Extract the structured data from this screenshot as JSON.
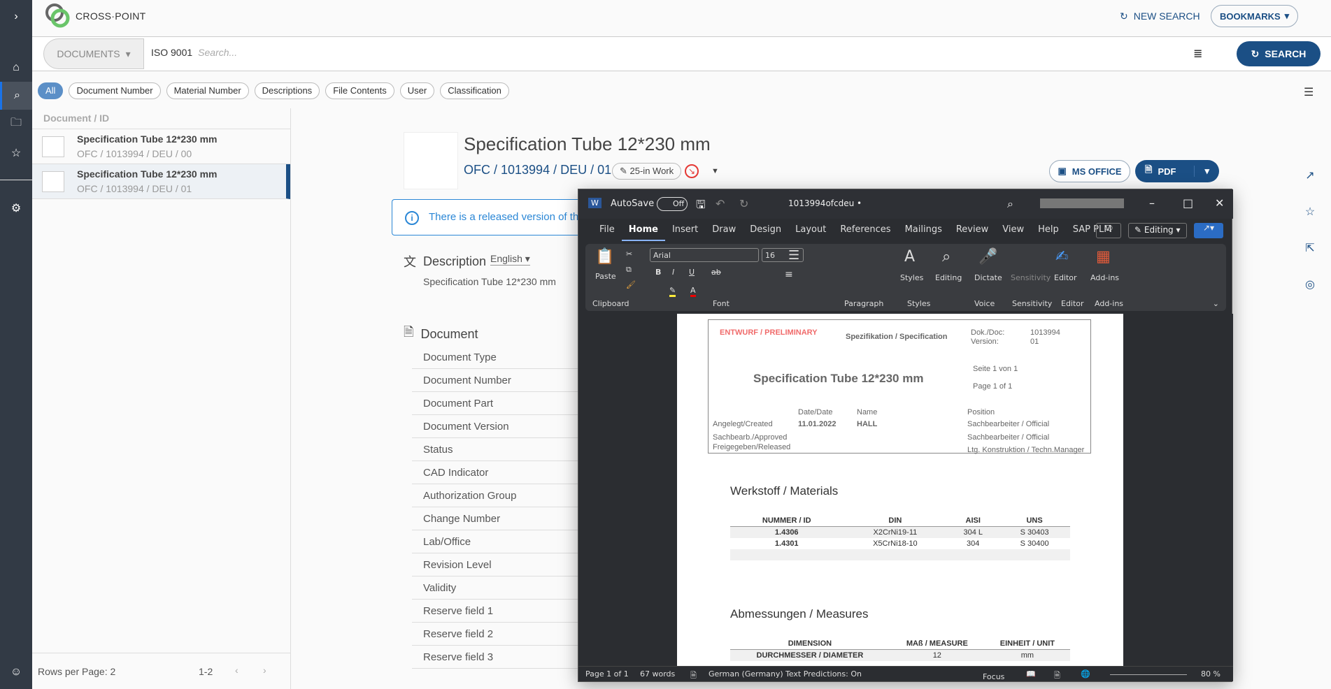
{
  "app": {
    "brand": "CROSS·POINT",
    "new_search": "NEW SEARCH",
    "bookmarks": "BOOKMARKS"
  },
  "rail": {
    "items": [
      "expand-icon",
      "home-icon",
      "search-icon",
      "folder-icon",
      "star-icon",
      "gear-icon",
      "user-icon"
    ],
    "active": "search-icon"
  },
  "search": {
    "scope": "DOCUMENTS",
    "query": "ISO 9001",
    "placeholder": "Search...",
    "button": "SEARCH"
  },
  "chips": [
    "All",
    "Document Number",
    "Material Number",
    "Descriptions",
    "File Contents",
    "User",
    "Classification"
  ],
  "list": {
    "header": "Document / ID",
    "items": [
      {
        "title": "Specification Tube 12*230 mm",
        "id": "OFC / 1013994 / DEU / 00",
        "selected": false
      },
      {
        "title": "Specification Tube 12*230 mm",
        "id": "OFC / 1013994 / DEU / 01",
        "selected": true
      }
    ],
    "rows_per_page": "Rows per Page: 2",
    "range": "1-2"
  },
  "detail": {
    "title": "Specification Tube 12*230 mm",
    "id": "OFC / 1013994 / DEU / 01",
    "status": "25-in Work",
    "info": "There is a released version of this",
    "ms_office": "MS OFFICE",
    "pdf": "PDF",
    "description_heading": "Description",
    "language": "English",
    "description": "Specification Tube 12*230 mm",
    "document_heading": "Document",
    "fields": [
      "Document Type",
      "Document Number",
      "Document Part",
      "Document Version",
      "Status",
      "CAD Indicator",
      "Authorization Group",
      "Change Number",
      "Lab/Office",
      "Revision Level",
      "Validity",
      "Reserve field 1",
      "Reserve field 2",
      "Reserve field 3"
    ]
  },
  "word": {
    "autosave": "AutoSave",
    "autosave_state": "Off",
    "filename": "1013994ofcdeu •",
    "menu": [
      "File",
      "Home",
      "Insert",
      "Draw",
      "Design",
      "Layout",
      "References",
      "Mailings",
      "Review",
      "View",
      "Help",
      "SAP PLM"
    ],
    "active_menu": "Home",
    "editing": "Editing",
    "font": "Arial",
    "size": "16",
    "groups": [
      "Clipboard",
      "Font",
      "Paragraph",
      "Styles",
      "Voice",
      "Sensitivity",
      "Editor",
      "Add-ins"
    ],
    "big_buttons": [
      "Paste",
      "Styles",
      "Editing",
      "Dictate",
      "Sensitivity",
      "Editor",
      "Add-ins"
    ],
    "doc": {
      "draft": "ENTWURF / PRELIMINARY",
      "spec": "Spezifikation / Specification",
      "doc_label": "Dok./Doc:",
      "doc_no": "1013994",
      "ver_label": "Version:",
      "ver": "01",
      "title": "Specification Tube 12*230 mm",
      "page_de": "Seite 1 von 1",
      "page_en": "Page 1 of 1",
      "date_h": "Date/Date",
      "name_h": "Name",
      "pos_h": "Position",
      "rows": [
        {
          "label": "Angelegt/Created",
          "date": "11.01.2022",
          "name": "HALL",
          "pos": "Sachbearbeiter / Official"
        },
        {
          "label": "Sachbearb./Approved",
          "date": "",
          "name": "",
          "pos": "Sachbearbeiter / Official"
        },
        {
          "label": "Freigegeben/Released",
          "date": "",
          "name": "",
          "pos": "Ltg. Konstruktion / Techn.Manager"
        }
      ],
      "materials_h": "Werkstoff / Materials",
      "mat_cols": [
        "NUMMER / ID",
        "DIN",
        "AISI",
        "UNS"
      ],
      "mat_rows": [
        [
          "1.4306",
          "X2CrNi19-11",
          "304 L",
          "S 30403"
        ],
        [
          "1.4301",
          "X5CrNi18-10",
          "304",
          "S 30400"
        ]
      ],
      "measures_h": "Abmessungen / Measures",
      "meas_cols": [
        "DIMENSION",
        "MAß / MEASURE",
        "EINHEIT / UNIT"
      ],
      "meas_rows": [
        [
          "DURCHMESSER / DIAMETER",
          "12",
          "mm"
        ]
      ]
    },
    "status": {
      "page": "Page 1 of 1",
      "words": "67 words",
      "lang": "German (Germany)",
      "pred": "Text Predictions: On",
      "focus": "Focus",
      "zoom": "80 %"
    }
  }
}
